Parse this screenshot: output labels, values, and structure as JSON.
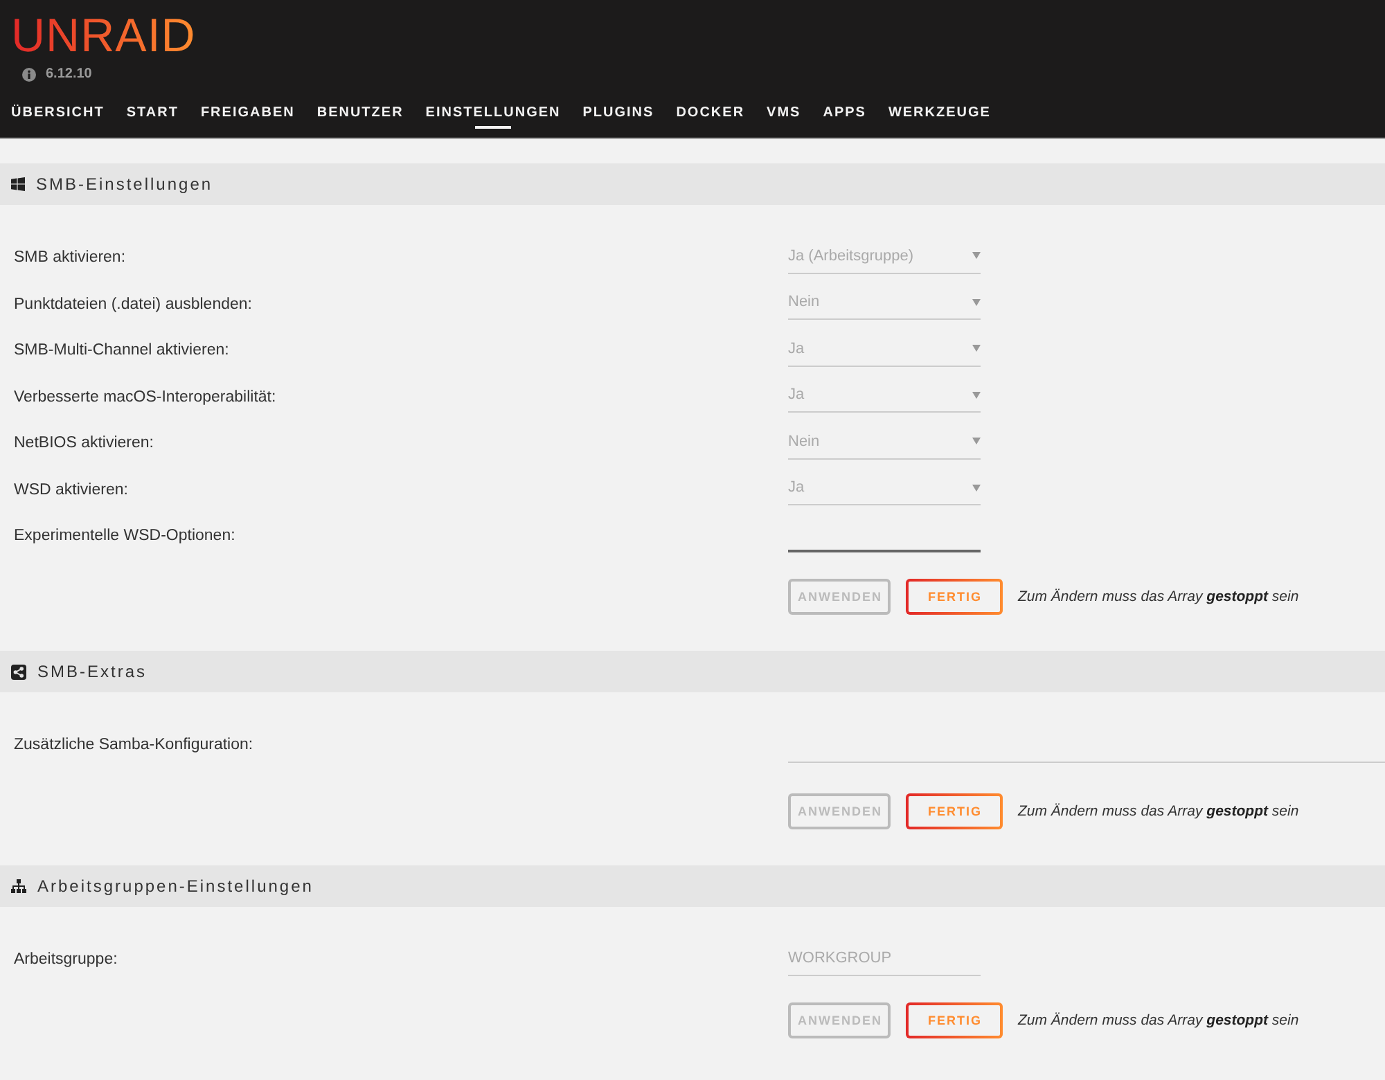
{
  "header": {
    "logo": "UNRAID",
    "version": "6.12.10",
    "nav": [
      {
        "label": "ÜBERSICHT",
        "selected": false
      },
      {
        "label": "START",
        "selected": false
      },
      {
        "label": "FREIGABEN",
        "selected": false
      },
      {
        "label": "BENUTZER",
        "selected": false
      },
      {
        "label": "EINSTELLUNGEN",
        "selected": true
      },
      {
        "label": "PLUGINS",
        "selected": false
      },
      {
        "label": "DOCKER",
        "selected": false
      },
      {
        "label": "VMS",
        "selected": false
      },
      {
        "label": "APPS",
        "selected": false
      },
      {
        "label": "WERKZEUGE",
        "selected": false
      }
    ]
  },
  "sections": [
    {
      "title": "SMB-Einstellungen",
      "fields": [
        {
          "kind": "select",
          "label": "SMB aktivieren:",
          "value": "Ja (Arbeitsgruppe)",
          "disabled": true
        },
        {
          "kind": "select",
          "label": "Punktdateien (.datei) ausblenden:",
          "value": "Nein",
          "disabled": true
        },
        {
          "kind": "select",
          "label": "SMB-Multi-Channel aktivieren:",
          "value": "Ja",
          "disabled": true
        },
        {
          "kind": "select",
          "label": "Verbesserte macOS-Interoperabilität:",
          "value": "Ja",
          "disabled": true
        },
        {
          "kind": "select",
          "label": "NetBIOS aktivieren:",
          "value": "Nein",
          "disabled": true
        },
        {
          "kind": "select",
          "label": "WSD aktivieren:",
          "value": "Ja",
          "disabled": true
        },
        {
          "kind": "text",
          "label": "Experimentelle WSD-Optionen:",
          "disabled": false
        }
      ],
      "buttons": [
        {
          "label": "ANWENDEN",
          "disabled": true
        },
        {
          "label": "FERTIG",
          "disabled": false
        }
      ],
      "note": "Zum Ändern muss das Array **gestoppt** sein"
    },
    {
      "title": "SMB-Extras",
      "fields": [
        {
          "kind": "textarea",
          "label": "Zusätzliche Samba-Konfiguration:",
          "disabled": true
        }
      ],
      "buttons": [
        {
          "label": "ANWENDEN",
          "disabled": true
        },
        {
          "label": "FERTIG",
          "disabled": false
        }
      ],
      "note": "Zum Ändern muss das Array **gestoppt** sein"
    },
    {
      "title": "Arbeitsgruppen-Einstellungen",
      "fields": [
        {
          "kind": "text",
          "label": "Arbeitsgruppe:",
          "value": "WORKGROUP",
          "disabled": true
        }
      ],
      "buttons": [
        {
          "label": "ANWENDEN",
          "disabled": true
        },
        {
          "label": "FERTIG",
          "disabled": false
        }
      ],
      "note": "Zum Ändern muss das Array **gestoppt** sein"
    }
  ]
}
